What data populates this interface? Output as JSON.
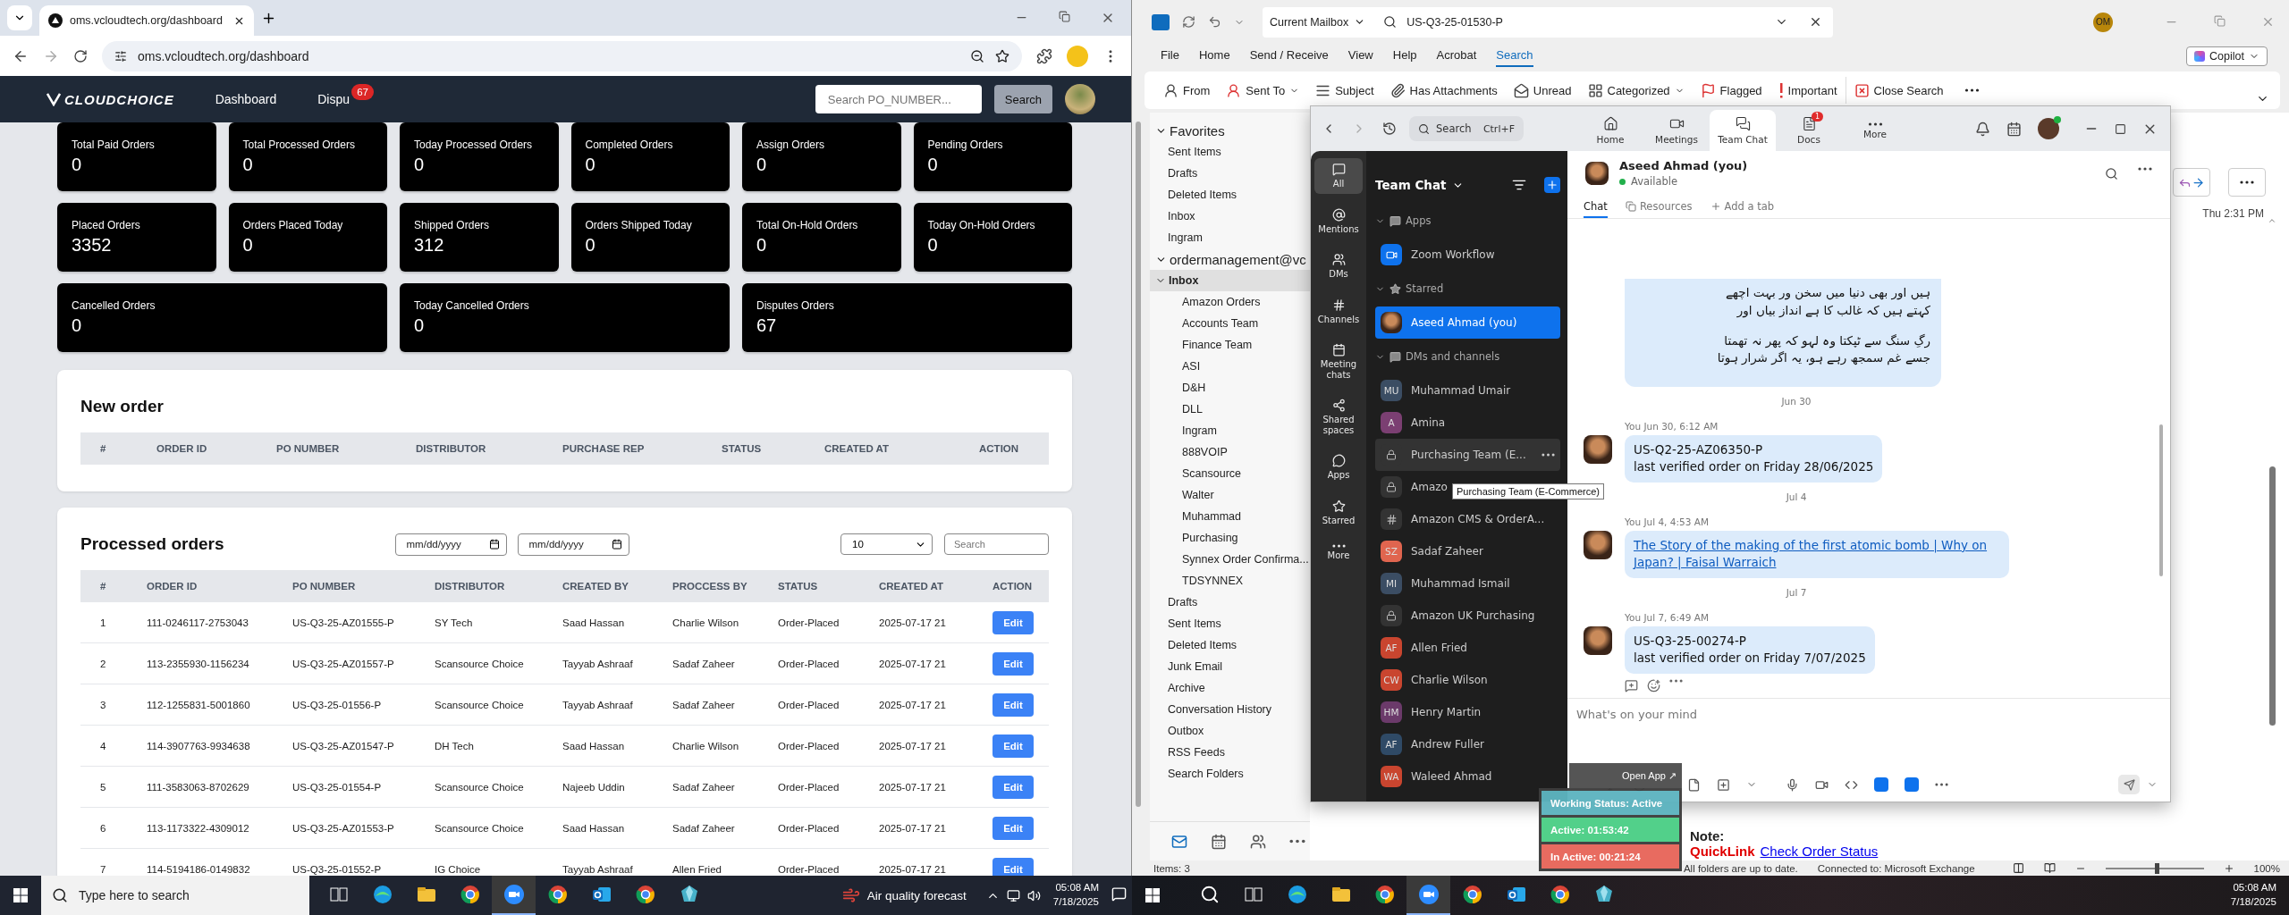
{
  "chrome": {
    "tab_title": "oms.vcloudtech.org/dashboard",
    "url": "oms.vcloudtech.org/dashboard"
  },
  "oms": {
    "brand": "CLOUDCHOICE",
    "nav": [
      {
        "label": "Dashboard"
      },
      {
        "label": "Dispu",
        "badge": "67"
      }
    ],
    "search": {
      "placeholder": "Search PO_NUMBER..."
    },
    "search_button": "Search",
    "stats": [
      {
        "label": "Total Paid Orders",
        "value": "0",
        "kind": "normal"
      },
      {
        "label": "Total Processed Orders",
        "value": "0",
        "kind": "normal"
      },
      {
        "label": "Today Processed Orders",
        "value": "0",
        "kind": "normal"
      },
      {
        "label": "Completed Orders",
        "value": "0",
        "kind": "normal"
      },
      {
        "label": "Assign Orders",
        "value": "0",
        "kind": "normal"
      },
      {
        "label": "Pending Orders",
        "value": "0",
        "kind": "normal"
      },
      {
        "label": "Placed Orders",
        "value": "3352",
        "kind": "normal"
      },
      {
        "label": "Orders Placed Today",
        "value": "0",
        "kind": "normal"
      },
      {
        "label": "Shipped Orders",
        "value": "312",
        "kind": "normal"
      },
      {
        "label": "Orders Shipped Today",
        "value": "0",
        "kind": "normal"
      },
      {
        "label": "Total On-Hold Orders",
        "value": "0",
        "kind": "normal"
      },
      {
        "label": "Today On-Hold Orders",
        "value": "0",
        "kind": "normal"
      },
      {
        "label": "Cancelled Orders",
        "value": "0",
        "kind": "wide"
      },
      {
        "label": "Today Cancelled Orders",
        "value": "0",
        "kind": "wide"
      },
      {
        "label": "Disputes Orders",
        "value": "67",
        "kind": "wide"
      }
    ],
    "new_order": {
      "title": "New order",
      "columns": [
        "#",
        "ORDER ID",
        "PO NUMBER",
        "DISTRIBUTOR",
        "PURCHASE REP",
        "STATUS",
        "CREATED AT",
        "ACTION"
      ]
    },
    "processed": {
      "title": "Processed orders",
      "date_from": {
        "placeholder": "mm/dd/yyyy"
      },
      "date_to": {
        "placeholder": "mm/dd/yyyy"
      },
      "page_size": "10",
      "search": {
        "placeholder": "Search"
      },
      "columns": [
        "#",
        "ORDER ID",
        "PO NUMBER",
        "DISTRIBUTOR",
        "CREATED BY",
        "PROCCESS BY",
        "STATUS",
        "CREATED AT",
        "ACTION"
      ],
      "rows": [
        {
          "cells": [
            "1",
            "111-0246117-2753043",
            "US-Q3-25-AZ01555-P",
            "SY Tech",
            "Saad Hassan",
            "Charlie Wilson",
            "Order-Placed",
            "2025-07-17 21"
          ],
          "action": "Edit"
        },
        {
          "cells": [
            "2",
            "113-2355930-1156234",
            "US-Q3-25-AZ01557-P",
            "Scansource Choice",
            "Tayyab Ashraaf",
            "Sadaf Zaheer",
            "Order-Placed",
            "2025-07-17 21"
          ],
          "action": "Edit"
        },
        {
          "cells": [
            "3",
            "112-1255831-5001860",
            "US-Q3-25-01556-P",
            "Scansource Choice",
            "Tayyab Ashraaf",
            "Sadaf Zaheer",
            "Order-Placed",
            "2025-07-17 21"
          ],
          "action": "Edit"
        },
        {
          "cells": [
            "4",
            "114-3907763-9934638",
            "US-Q3-25-AZ01547-P",
            "DH Tech",
            "Saad Hassan",
            "Charlie Wilson",
            "Order-Placed",
            "2025-07-17 21"
          ],
          "action": "Edit"
        },
        {
          "cells": [
            "5",
            "111-3583063-8702629",
            "US-Q3-25-01554-P",
            "Scansource Choice",
            "Najeeb Uddin",
            "Sadaf Zaheer",
            "Order-Placed",
            "2025-07-17 21"
          ],
          "action": "Edit"
        },
        {
          "cells": [
            "6",
            "113-1173322-4309012",
            "US-Q3-25-AZ01553-P",
            "Scansource Choice",
            "Saad Hassan",
            "Sadaf Zaheer",
            "Order-Placed",
            "2025-07-17 21"
          ],
          "action": "Edit"
        },
        {
          "cells": [
            "7",
            "114-5194186-0149832",
            "US-Q3-25-01552-P",
            "IG Choice",
            "Tayyab Ashraaf",
            "Allen Fried",
            "Order-Placed",
            "2025-07-17 21"
          ],
          "action": "Edit"
        }
      ]
    }
  },
  "outlook": {
    "scope": "Current Mailbox",
    "search": {
      "value": "US-Q3-25-01530-P"
    },
    "account_initials": "OM",
    "menu": [
      {
        "label": "File",
        "selected": false
      },
      {
        "label": "Home",
        "selected": false
      },
      {
        "label": "Send / Receive",
        "selected": false
      },
      {
        "label": "View",
        "selected": false
      },
      {
        "label": "Help",
        "selected": false
      },
      {
        "label": "Acrobat",
        "selected": false
      },
      {
        "label": "Search",
        "selected": true
      }
    ],
    "copilot": "Copilot",
    "ribbon": [
      {
        "label": "From",
        "dropdown": false
      },
      {
        "label": "Sent To",
        "dropdown": true
      },
      {
        "label": "Subject",
        "dropdown": false
      },
      {
        "label": "Has Attachments",
        "dropdown": false
      },
      {
        "label": "Unread",
        "dropdown": false
      },
      {
        "label": "Categorized",
        "dropdown": true
      },
      {
        "label": "Flagged",
        "dropdown": false
      },
      {
        "label": "Important",
        "dropdown": false
      },
      {
        "label": "Close Search",
        "dropdown": false
      }
    ],
    "favorites": {
      "title": "Favorites",
      "expanded": true,
      "items": [
        {
          "label": "Sent Items",
          "selected": false
        },
        {
          "label": "Drafts",
          "selected": false
        },
        {
          "label": "Deleted Items",
          "selected": false
        },
        {
          "label": "Inbox",
          "selected": false
        },
        {
          "label": "Ingram",
          "selected": false
        }
      ]
    },
    "account": {
      "title": "ordermanagement@vc",
      "expanded": true
    },
    "folders": [
      {
        "label": "Inbox",
        "selected": true,
        "expanded": true,
        "children": [
          {
            "label": "Amazon Orders",
            "selected": false
          },
          {
            "label": "Accounts Team",
            "selected": false
          },
          {
            "label": "Finance Team",
            "selected": false
          },
          {
            "label": "ASI",
            "selected": false
          },
          {
            "label": "D&H",
            "selected": false
          },
          {
            "label": "DLL",
            "selected": false
          },
          {
            "label": "Ingram",
            "selected": false
          },
          {
            "label": "888VOIP",
            "selected": false
          },
          {
            "label": "Scansource",
            "selected": false
          },
          {
            "label": "Walter",
            "selected": false
          },
          {
            "label": "Muhammad",
            "selected": false
          },
          {
            "label": "Purchasing",
            "selected": false
          },
          {
            "label": "Synnex Order Confirma...",
            "selected": false
          },
          {
            "label": "TDSYNNEX",
            "selected": false
          }
        ]
      },
      {
        "label": "Drafts",
        "selected": false
      },
      {
        "label": "Sent Items",
        "selected": false
      },
      {
        "label": "Deleted Items",
        "selected": false
      },
      {
        "label": "Junk Email",
        "selected": false
      },
      {
        "label": "Archive",
        "selected": false
      },
      {
        "label": "Conversation History",
        "selected": false
      },
      {
        "label": "Outbox",
        "selected": false
      },
      {
        "label": "RSS Feeds",
        "selected": false
      },
      {
        "label": "Search Folders",
        "selected": false
      }
    ],
    "received": "Thu 2:31 PM",
    "note": {
      "label": "Note:",
      "quicklink": "QuickLink",
      "link": "Check Order Status"
    },
    "status_bar": {
      "items": "Items: 3",
      "sync": "All folders are up to date.",
      "connection": "Connected to: Microsoft Exchange",
      "zoom": "100%",
      "level": 0.5
    }
  },
  "zoom": {
    "search": {
      "placeholder": "Search",
      "shortcut": "Ctrl+F"
    },
    "tabs": [
      {
        "label": "Home",
        "selected": false
      },
      {
        "label": "Meetings",
        "selected": false
      },
      {
        "label": "Team Chat",
        "selected": true
      },
      {
        "label": "Docs",
        "selected": false,
        "badge": "1"
      },
      {
        "label": "More",
        "selected": false
      }
    ],
    "rail": [
      {
        "label": "All",
        "selected": true
      },
      {
        "label": "Mentions",
        "selected": false
      },
      {
        "label": "DMs",
        "selected": false
      },
      {
        "label": "Channels",
        "selected": false
      },
      {
        "label": "Meeting chats",
        "selected": false
      },
      {
        "label": "Shared spaces",
        "selected": false
      },
      {
        "label": "Apps",
        "selected": false
      },
      {
        "label": "Starred",
        "selected": false
      },
      {
        "label": "More",
        "selected": false
      }
    ],
    "list_title": "Team Chat",
    "sections": [
      {
        "title": "Apps",
        "expanded": true,
        "items": [
          {
            "kind": "app",
            "label": "Zoom Workflow",
            "selected": false,
            "hovered": false
          }
        ]
      },
      {
        "title": "Starred",
        "expanded": true,
        "items": [
          {
            "kind": "self",
            "label": "Aseed Ahmad (you)",
            "selected": true,
            "hovered": false
          }
        ]
      },
      {
        "title": "DMs and channels",
        "expanded": true,
        "items": [
          {
            "kind": "person",
            "initials": "MU",
            "color": "#3b4d63",
            "label": "Muhammad Umair",
            "selected": false,
            "hovered": false
          },
          {
            "kind": "person",
            "initials": "A",
            "color": "#7b3f72",
            "label": "Amina",
            "selected": false,
            "hovered": false
          },
          {
            "kind": "private",
            "label": "Purchasing Team (E...",
            "selected": false,
            "hovered": true
          },
          {
            "kind": "private",
            "label": "Amazo",
            "selected": false,
            "hovered": false
          },
          {
            "kind": "channel",
            "label": "Amazon CMS & OrderA...",
            "selected": false,
            "hovered": false
          },
          {
            "kind": "person",
            "initials": "SZ",
            "color": "#e0654f",
            "label": "Sadaf Zaheer",
            "selected": false,
            "hovered": false
          },
          {
            "kind": "person",
            "initials": "MI",
            "color": "#3b4d63",
            "label": "Muhammad Ismail",
            "selected": false,
            "hovered": false
          },
          {
            "kind": "private",
            "label": "Amazon UK Purchasing",
            "selected": false,
            "hovered": false
          },
          {
            "kind": "person",
            "initials": "AF",
            "color": "#c9452f",
            "label": "Allen Fried",
            "selected": false,
            "hovered": false
          },
          {
            "kind": "person",
            "initials": "CW",
            "color": "#c9452f",
            "label": "Charlie Wilson",
            "selected": false,
            "hovered": false
          },
          {
            "kind": "person",
            "initials": "HM",
            "color": "#6b3a6a",
            "label": "Henry Martin",
            "selected": false,
            "hovered": false
          },
          {
            "kind": "person",
            "initials": "AF",
            "color": "#2f4a66",
            "label": "Andrew Fuller",
            "selected": false,
            "hovered": false
          },
          {
            "kind": "person",
            "initials": "WA",
            "color": "#c9452f",
            "label": "Waleed Ahmad",
            "selected": false,
            "hovered": false
          }
        ]
      }
    ],
    "tooltip": "Purchasing Team (E-Commerce)",
    "chat": {
      "name": "Aseed Ahmad (you)",
      "status": "Available",
      "tabs": [
        {
          "label": "Chat",
          "selected": true
        },
        {
          "label": "Resources",
          "selected": false
        },
        {
          "label": "Add a tab",
          "selected": false
        }
      ],
      "messages": [
        {
          "kind": "poem",
          "stanzas": [
            [
              "ہیں اور بھی دنیا میں سخن ور بہت اچھے",
              "کہتے ہیں کہ غالب کا ہے انداز بیاں اور"
            ],
            [
              "رگِ سنگ سے ٹپکتا وہ لہو کہ پھر نہ تھمتا",
              "جسے غم سمجھ رہے ہو، یہ اگر شرار ہوتا"
            ]
          ]
        },
        {
          "kind": "date",
          "text": "Jun 30"
        },
        {
          "kind": "message",
          "meta": "You Jun 30, 6:12 AM",
          "lines": [
            "US-Q2-25-AZ06350-P",
            "last verified order on Friday 28/06/2025"
          ],
          "actions_shown": false
        },
        {
          "kind": "date",
          "text": "Jul 4"
        },
        {
          "kind": "link",
          "meta": "You Jul 4, 4:53 AM",
          "text": "The Story of the making of the first atomic bomb | Why on Japan? | Faisal Warraich",
          "actions_shown": false
        },
        {
          "kind": "date",
          "text": "Jul 7"
        },
        {
          "kind": "message",
          "meta": "You Jul 7, 6:49 AM",
          "lines": [
            "US-Q3-25-00274-P",
            "last verified order on Friday 7/07/2025"
          ],
          "actions_shown": true
        }
      ],
      "compose": {
        "placeholder": "What's on your mind"
      }
    }
  },
  "tracker": {
    "open_app": "Open App ↗",
    "rows": [
      {
        "text": "Working Status: Active",
        "color": "#5db4c0"
      },
      {
        "text": "Active: 01:53:42",
        "color": "#4ccf86"
      },
      {
        "text": "In Active: 00:21:24",
        "color": "#e8665a"
      }
    ]
  },
  "taskbar_left": {
    "search": {
      "placeholder": "Type here to search"
    },
    "weather": "Air quality forecast",
    "time": "05:08 AM",
    "date": "7/18/2025"
  },
  "taskbar_right": {
    "time": "05:08 AM",
    "date": "7/18/2025"
  }
}
